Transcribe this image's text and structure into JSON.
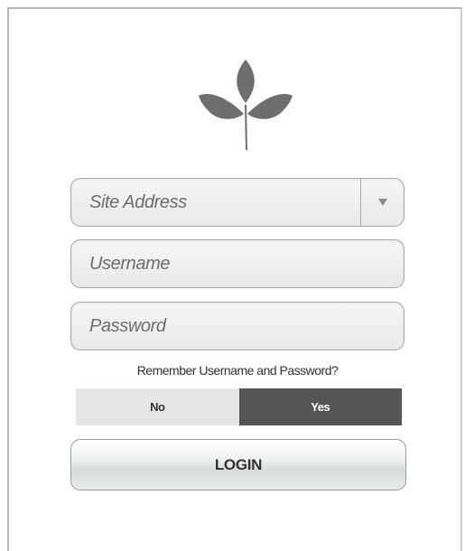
{
  "form": {
    "site_address": {
      "placeholder": "Site Address",
      "value": ""
    },
    "username": {
      "placeholder": "Username",
      "value": ""
    },
    "password": {
      "placeholder": "Password",
      "value": ""
    },
    "remember_label": "Remember Username and Password?",
    "remember_options": {
      "no": "No",
      "yes": "Yes"
    },
    "remember_selected": "yes",
    "login_label": "LOGIN"
  },
  "logo": {
    "icon": "leaf-sprout-icon",
    "color": "#6e6e6e"
  },
  "colors": {
    "toggle_selected_bg": "#555555",
    "toggle_unselected_bg": "#e6e6e6"
  }
}
